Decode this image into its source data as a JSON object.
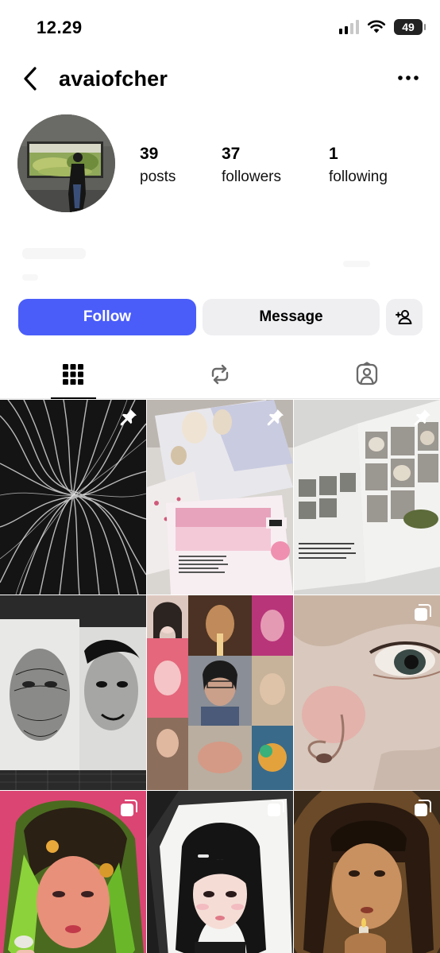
{
  "status_bar": {
    "time": "12.29",
    "battery": "49",
    "icons": [
      "signal-icon",
      "wifi-icon",
      "battery-icon"
    ]
  },
  "header": {
    "username": "avaiofcher",
    "icons": [
      "back-arrow-icon",
      "more-options-icon"
    ]
  },
  "profile": {
    "stats": [
      {
        "value": "39",
        "label": "posts"
      },
      {
        "value": "37",
        "label": "followers"
      },
      {
        "value": "1",
        "label": "following"
      }
    ]
  },
  "actions": {
    "follow_label": "Follow",
    "message_label": "Message",
    "add_user_icon": "add-person-icon"
  },
  "tabs": [
    {
      "name": "grid",
      "icon": "grid-icon",
      "selected": true
    },
    {
      "name": "reels",
      "icon": "repost-icon",
      "selected": false
    },
    {
      "name": "tagged",
      "icon": "tagged-person-icon",
      "selected": false
    }
  ],
  "posts": [
    {
      "badge": "pin-icon",
      "subject": "black and white abstract lines"
    },
    {
      "badge": "pin-icon",
      "subject": "editorial print spread with pink pages"
    },
    {
      "badge": "pin-icon",
      "subject": "open magazine with textured images"
    },
    {
      "badge": "none",
      "subject": "black and white pen drawings of faces"
    },
    {
      "badge": "none",
      "subject": "collage of portrait artworks"
    },
    {
      "badge": "carousel-icon",
      "subject": "close-up painted face"
    },
    {
      "badge": "carousel-icon",
      "subject": "colorful portrait of girl with green hair"
    },
    {
      "badge": "carousel-icon",
      "subject": "digital portrait on tablet"
    },
    {
      "badge": "carousel-icon",
      "subject": "painted portrait holding lighter"
    }
  ],
  "colors": {
    "follow_button": "#4a5df9",
    "secondary_button": "#efeff2"
  }
}
